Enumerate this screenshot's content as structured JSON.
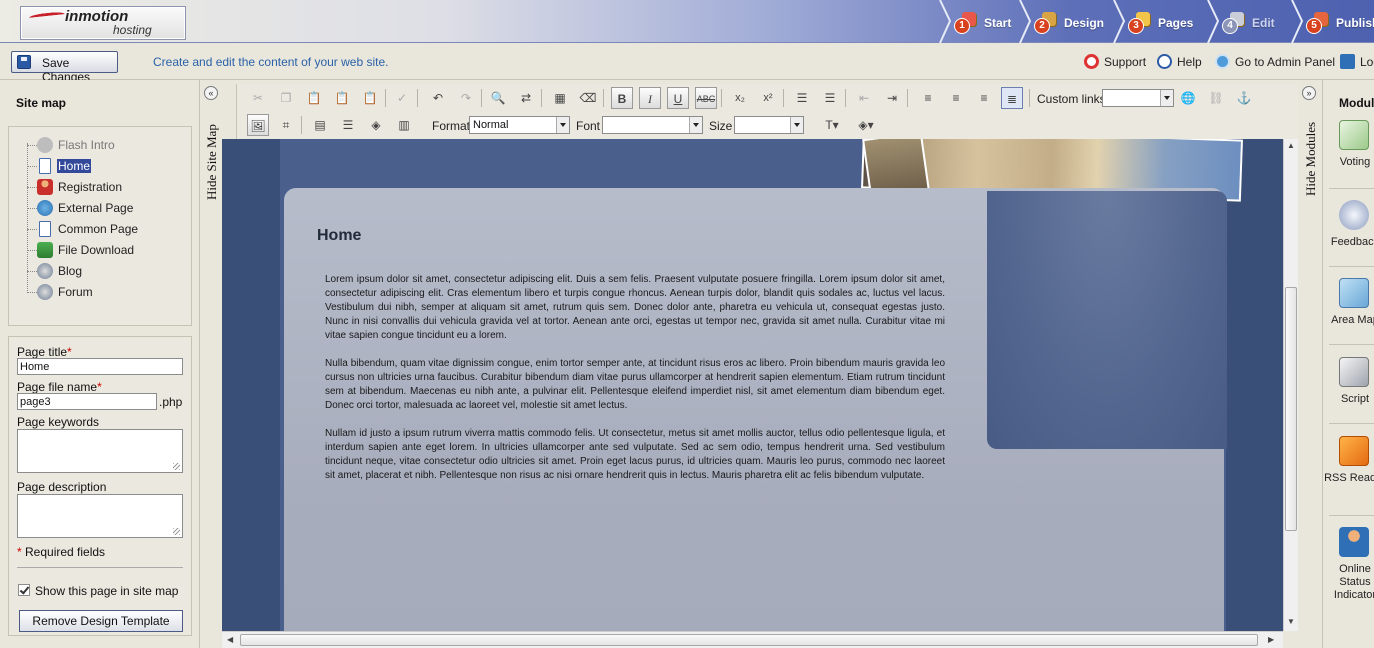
{
  "brand": {
    "logo_main": "inmotion",
    "logo_sub": "hosting"
  },
  "steps": [
    {
      "num": "1",
      "label": "Start"
    },
    {
      "num": "2",
      "label": "Design"
    },
    {
      "num": "3",
      "label": "Pages"
    },
    {
      "num": "4",
      "label": "Edit"
    },
    {
      "num": "5",
      "label": "Publish"
    }
  ],
  "subbar": {
    "save_label": "Save Changes",
    "subtitle": "Create and edit the content of your web site.",
    "links": {
      "support": "Support",
      "help": "Help",
      "admin": "Go to Admin Panel",
      "logout": "Log out"
    }
  },
  "sitemap": {
    "title": "Site map",
    "hide_label": "Hide Site Map",
    "items": [
      {
        "label": "Flash Intro",
        "icon": "flash-icon"
      },
      {
        "label": "Home",
        "icon": "page-icon"
      },
      {
        "label": "Registration",
        "icon": "user-icon"
      },
      {
        "label": "External Page",
        "icon": "globe-icon"
      },
      {
        "label": "Common Page",
        "icon": "page-icon"
      },
      {
        "label": "File Download",
        "icon": "download-icon"
      },
      {
        "label": "Blog",
        "icon": "blog-icon"
      },
      {
        "label": "Forum",
        "icon": "forum-icon"
      }
    ]
  },
  "props": {
    "page_title_label": "Page title",
    "page_title_value": "Home",
    "file_name_label": "Page file name",
    "file_name_value": "page3",
    "file_ext": ".php",
    "keywords_label": "Page keywords",
    "description_label": "Page description",
    "required_note": "Required fields",
    "required_mark": "*",
    "show_in_sitemap": "Show this page in site map",
    "remove_template": "Remove Design Template"
  },
  "toolbar": {
    "custom_links": "Custom links",
    "format_label": "Format",
    "format_value": "Normal",
    "font_label": "Font",
    "size_label": "Size"
  },
  "content": {
    "heading": "Home",
    "paragraphs": [
      "Lorem ipsum dolor sit amet, consectetur adipiscing elit. Duis a sem felis. Praesent vulputate posuere fringilla. Lorem ipsum dolor sit amet, consectetur adipiscing elit. Cras elementum libero et turpis congue rhoncus. Aenean turpis dolor, blandit quis sodales ac, luctus vel lacus. Vestibulum dui nibh, semper at aliquam sit amet, rutrum quis sem. Donec dolor ante, pharetra eu vehicula ut, consequat egestas justo. Nunc in nisi convallis dui vehicula gravida vel at tortor. Aenean ante orci, egestas ut tempor nec, gravida sit amet nulla. Curabitur vitae mi vitae sapien congue tincidunt eu a lorem.",
      "Nulla bibendum, quam vitae dignissim congue, enim tortor semper ante, at tincidunt risus eros ac libero. Proin bibendum mauris gravida leo cursus non ultricies urna faucibus. Curabitur bibendum diam vitae purus ullamcorper at hendrerit sapien elementum. Etiam rutrum tincidunt sem at bibendum. Maecenas eu nibh ante, a pulvinar elit. Pellentesque eleifend imperdiet nisl, sit amet elementum diam bibendum eget. Donec orci tortor, malesuada ac laoreet vel, molestie sit amet lectus.",
      "Nullam id justo a ipsum rutrum viverra mattis commodo felis. Ut consectetur, metus sit amet mollis auctor, tellus odio pellentesque ligula, et interdum sapien ante eget lorem. In ultricies ullamcorper ante sed vulputate. Sed ac sem odio, tempus hendrerit urna. Sed vestibulum tincidunt neque, vitae consectetur odio ultricies sit amet. Proin eget lacus purus, id ultricies quam. Mauris leo purus, commodo nec laoreet sit amet, placerat et nibh. Pellentesque non risus ac nisi ornare hendrerit quis in lectus. Mauris pharetra elit ac felis bibendum vulputate."
    ]
  },
  "modules": {
    "title": "Modules",
    "hide_label": "Hide Modules",
    "items": [
      {
        "label": "Voting",
        "icon": "voting-icon"
      },
      {
        "label": "Feedback",
        "icon": "feedback-icon"
      },
      {
        "label": "Area Map",
        "icon": "map-icon"
      },
      {
        "label": "Script",
        "icon": "script-icon"
      },
      {
        "label": "RSS Reader",
        "icon": "rss-icon"
      },
      {
        "label": "Online Status Indicator",
        "icon": "status-icon"
      }
    ]
  }
}
